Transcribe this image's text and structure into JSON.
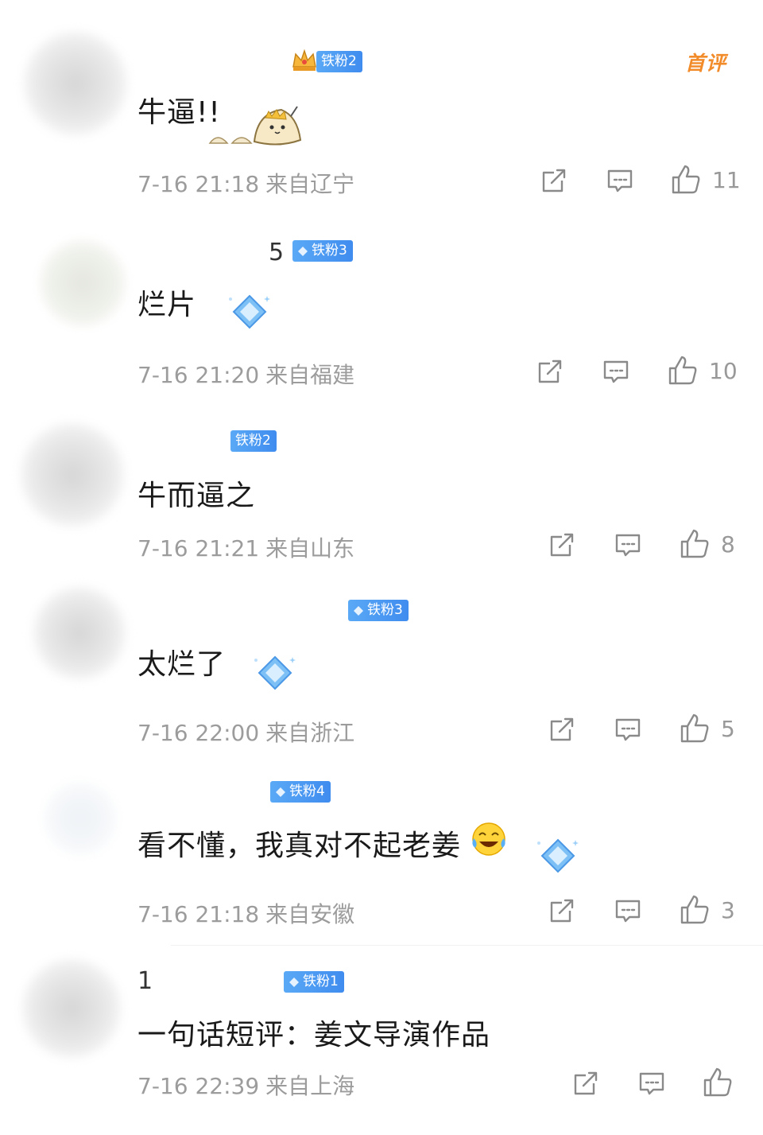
{
  "first_comment_tag": "首评",
  "icons": {
    "share": "share-icon",
    "reply": "comment-icon",
    "like": "thumbs-up-icon",
    "badge_gem": "diamond-icon",
    "badge_crown": "crown-icon"
  },
  "colors": {
    "badge": "#4a98f2",
    "first_tag": "#f28b2a",
    "meta_text": "#9c9c9c",
    "icon": "#8a8a8a"
  },
  "comments": [
    {
      "username": "",
      "badge": "铁粉2",
      "text": "牛逼!!",
      "time": "7-16 21:18",
      "location": "来自辽宁",
      "likes": "11"
    },
    {
      "username": "5",
      "badge": "铁粉3",
      "text": "烂片",
      "time": "7-16 21:20",
      "location": "来自福建",
      "likes": "10"
    },
    {
      "username": "",
      "badge": "铁粉2",
      "text": "牛而逼之",
      "time": "7-16 21:21",
      "location": "来自山东",
      "likes": "8"
    },
    {
      "username": "",
      "badge": "铁粉3",
      "text": "太烂了",
      "time": "7-16 22:00",
      "location": "来自浙江",
      "likes": "5"
    },
    {
      "username": "",
      "badge": "铁粉4",
      "text": "看不懂，我真对不起老姜",
      "time": "7-16 21:18",
      "location": "来自安徽",
      "likes": "3"
    },
    {
      "username": "1",
      "badge": "铁粉1",
      "text": "一句话短评：姜文导演作品",
      "time": "7-16 22:39",
      "location": "来自上海",
      "likes": ""
    }
  ]
}
